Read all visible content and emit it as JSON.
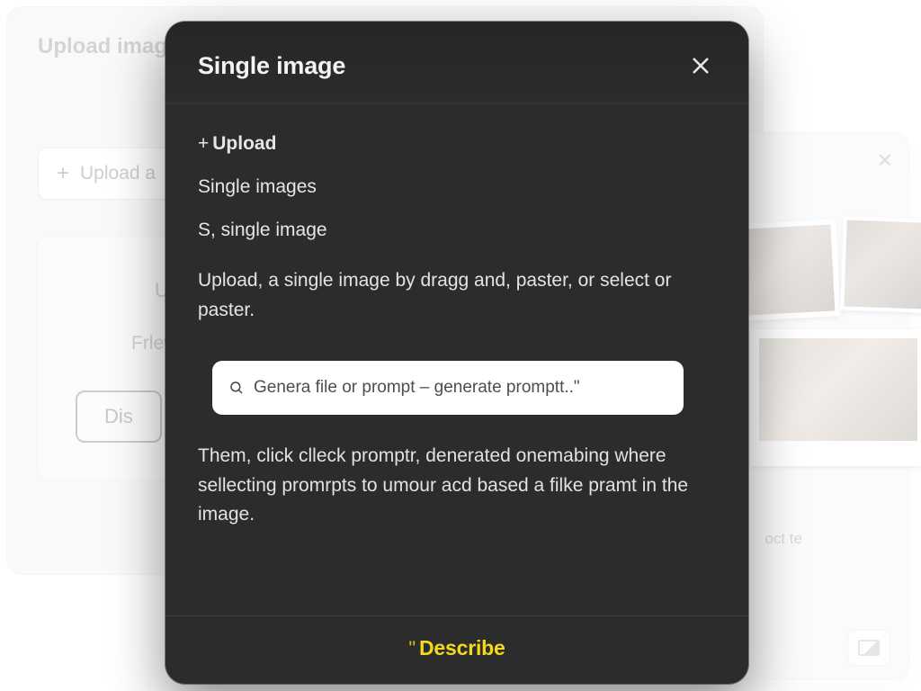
{
  "background": {
    "left_card": {
      "title": "Upload imag",
      "upload_button": "Upload a",
      "inner_letter": "U",
      "inner_subline": "Frlew",
      "dis_button": "Dis"
    },
    "right_card": {
      "label_lines": "oct\nte"
    }
  },
  "modal": {
    "title": "Single image",
    "rows": {
      "upload": "Upload",
      "single_images": "Single images",
      "s_single_image": "S, single image"
    },
    "description_1": "Upload, a single image by dragg and, paster, or select or paster.",
    "search": {
      "placeholder": "Genera file or prompt – generate promptt..\""
    },
    "description_2": "Them, click clleck promptr, denerated onemabing where sellecting promrpts to umour acd based a filke pramt in the image.",
    "footer_action": "Describe"
  }
}
